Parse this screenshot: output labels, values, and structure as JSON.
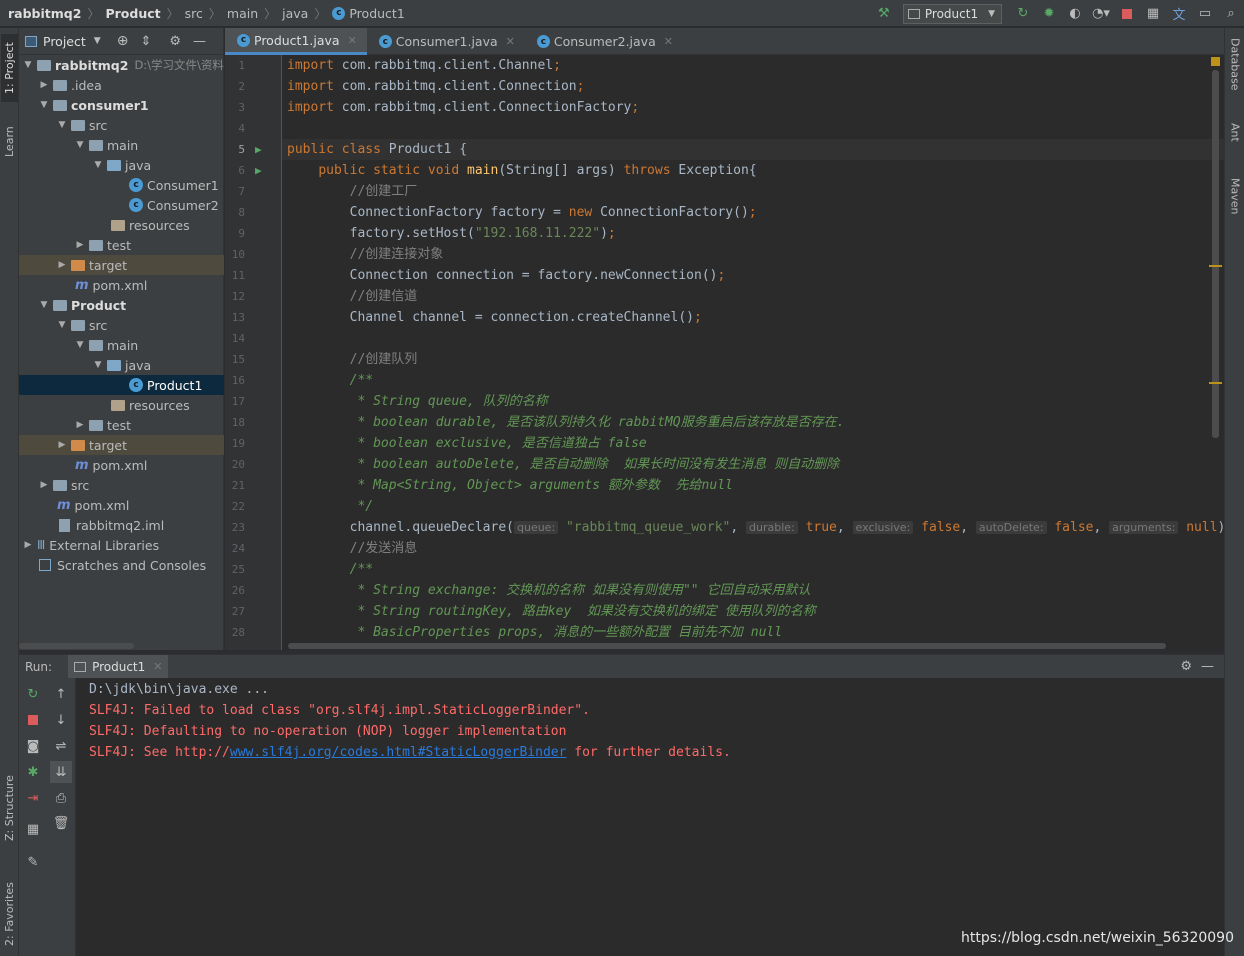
{
  "breadcrumbs": [
    "rabbitmq2",
    "Product",
    "src",
    "main",
    "java",
    "Product1"
  ],
  "run_config": "Product1",
  "left_strip": {
    "project_tab": "1: Project",
    "learn_tab": "Learn",
    "structure_tab": "Z: Structure",
    "favorites_tab": "2: Favorites"
  },
  "right_strip": {
    "database_tab": "Database",
    "ant_tab": "Ant",
    "maven_tab": "Maven"
  },
  "project_panel": {
    "title": "Project",
    "rows": [
      {
        "label": "rabbitmq2",
        "extra": "D:\\学习文件\\资料"
      },
      {
        "label": ".idea"
      },
      {
        "label": "consumer1"
      },
      {
        "label": "src"
      },
      {
        "label": "main"
      },
      {
        "label": "java"
      },
      {
        "label": "Consumer1"
      },
      {
        "label": "Consumer2"
      },
      {
        "label": "resources"
      },
      {
        "label": "test"
      },
      {
        "label": "target"
      },
      {
        "label": "pom.xml"
      },
      {
        "label": "Product"
      },
      {
        "label": "src"
      },
      {
        "label": "main"
      },
      {
        "label": "java"
      },
      {
        "label": "Product1"
      },
      {
        "label": "resources"
      },
      {
        "label": "test"
      },
      {
        "label": "target"
      },
      {
        "label": "pom.xml"
      },
      {
        "label": "src"
      },
      {
        "label": "pom.xml"
      },
      {
        "label": "rabbitmq2.iml"
      },
      {
        "label": "External Libraries"
      },
      {
        "label": "Scratches and Consoles"
      }
    ]
  },
  "tabs": [
    {
      "label": "Product1.java"
    },
    {
      "label": "Consumer1.java"
    },
    {
      "label": "Consumer2.java"
    }
  ],
  "editor": {
    "line_numbers": [
      "1",
      "2",
      "3",
      "4",
      "5",
      "6",
      "7",
      "8",
      "9",
      "10",
      "11",
      "12",
      "13",
      "14",
      "15",
      "16",
      "17",
      "18",
      "19",
      "20",
      "21",
      "22",
      "23",
      "24",
      "25",
      "26",
      "27",
      "28"
    ],
    "hints": {
      "queue": "queue:",
      "durable": "durable:",
      "exclusive": "exclusive:",
      "autoDelete": "autoDelete:",
      "arguments": "arguments:"
    }
  },
  "run_panel": {
    "label": "Run:",
    "tab": "Product1",
    "lines": [
      "D:\\jdk\\bin\\java.exe ...",
      "SLF4J: Failed to load class \"org.slf4j.impl.StaticLoggerBinder\".",
      "SLF4J: Defaulting to no-operation (NOP) logger implementation",
      "SLF4J: See http://"
    ],
    "link": "www.slf4j.org/codes.html#StaticLoggerBinder",
    "line4_tail": " for further details."
  },
  "watermark": "https://blog.csdn.net/weixin_56320090",
  "colors": {
    "accent": "#4a88c7",
    "error_text": "#ff6b68",
    "keyword": "#cc7832",
    "string": "#6a8759",
    "doc": "#629755"
  }
}
